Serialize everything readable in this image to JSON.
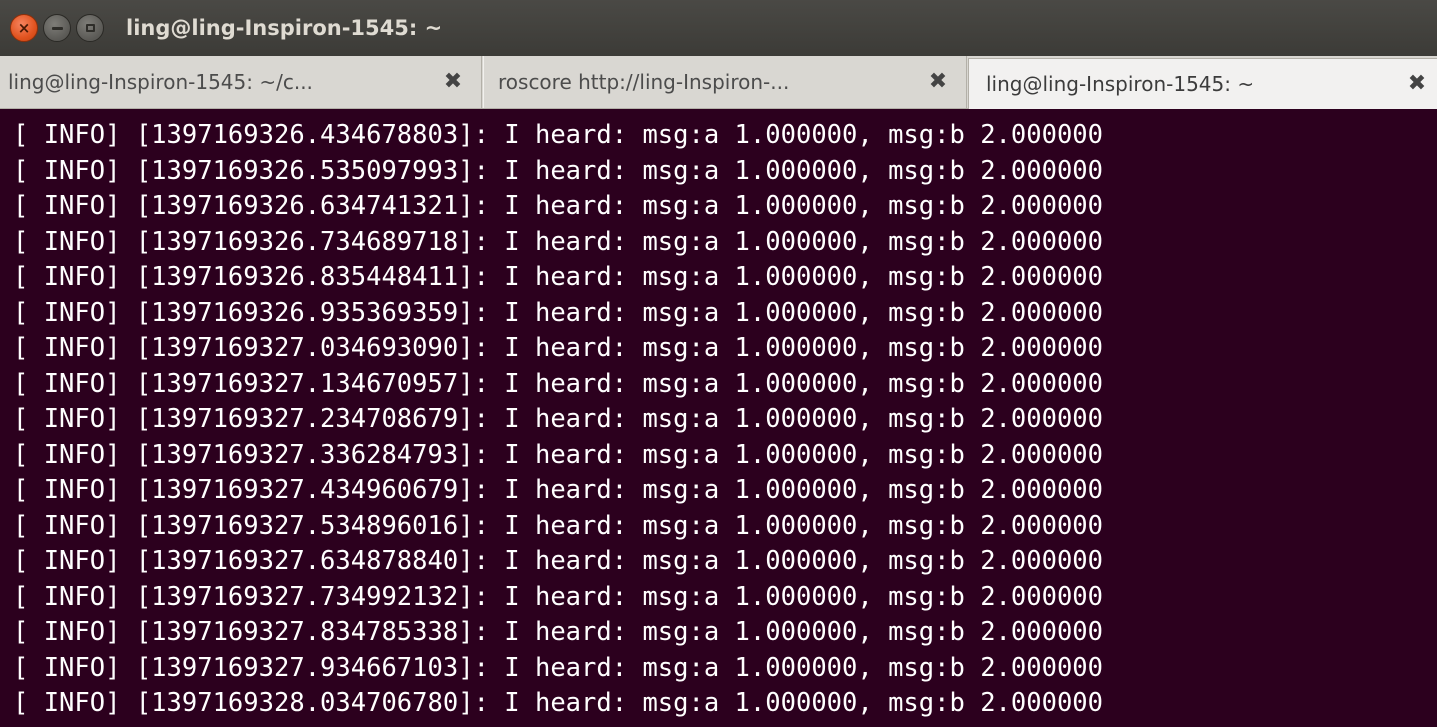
{
  "window": {
    "title": "ling@ling-Inspiron-1545: ~",
    "buttons": {
      "close_glyph": "×"
    }
  },
  "tabs": [
    {
      "label": "ling@ling-Inspiron-1545: ~/c...",
      "close_glyph": "✖",
      "active": false
    },
    {
      "label": "roscore http://ling-Inspiron-...",
      "close_glyph": "✖",
      "active": false
    },
    {
      "label": "ling@ling-Inspiron-1545: ~",
      "close_glyph": "✖",
      "active": true
    }
  ],
  "terminal": {
    "background": "#2c001e",
    "foreground": "#ffffff",
    "lines": [
      "[ INFO] [1397169326.434678803]: I heard: msg:a 1.000000, msg:b 2.000000",
      "[ INFO] [1397169326.535097993]: I heard: msg:a 1.000000, msg:b 2.000000",
      "[ INFO] [1397169326.634741321]: I heard: msg:a 1.000000, msg:b 2.000000",
      "[ INFO] [1397169326.734689718]: I heard: msg:a 1.000000, msg:b 2.000000",
      "[ INFO] [1397169326.835448411]: I heard: msg:a 1.000000, msg:b 2.000000",
      "[ INFO] [1397169326.935369359]: I heard: msg:a 1.000000, msg:b 2.000000",
      "[ INFO] [1397169327.034693090]: I heard: msg:a 1.000000, msg:b 2.000000",
      "[ INFO] [1397169327.134670957]: I heard: msg:a 1.000000, msg:b 2.000000",
      "[ INFO] [1397169327.234708679]: I heard: msg:a 1.000000, msg:b 2.000000",
      "[ INFO] [1397169327.336284793]: I heard: msg:a 1.000000, msg:b 2.000000",
      "[ INFO] [1397169327.434960679]: I heard: msg:a 1.000000, msg:b 2.000000",
      "[ INFO] [1397169327.534896016]: I heard: msg:a 1.000000, msg:b 2.000000",
      "[ INFO] [1397169327.634878840]: I heard: msg:a 1.000000, msg:b 2.000000",
      "[ INFO] [1397169327.734992132]: I heard: msg:a 1.000000, msg:b 2.000000",
      "[ INFO] [1397169327.834785338]: I heard: msg:a 1.000000, msg:b 2.000000",
      "[ INFO] [1397169327.934667103]: I heard: msg:a 1.000000, msg:b 2.000000",
      "[ INFO] [1397169328.034706780]: I heard: msg:a 1.000000, msg:b 2.000000"
    ]
  }
}
